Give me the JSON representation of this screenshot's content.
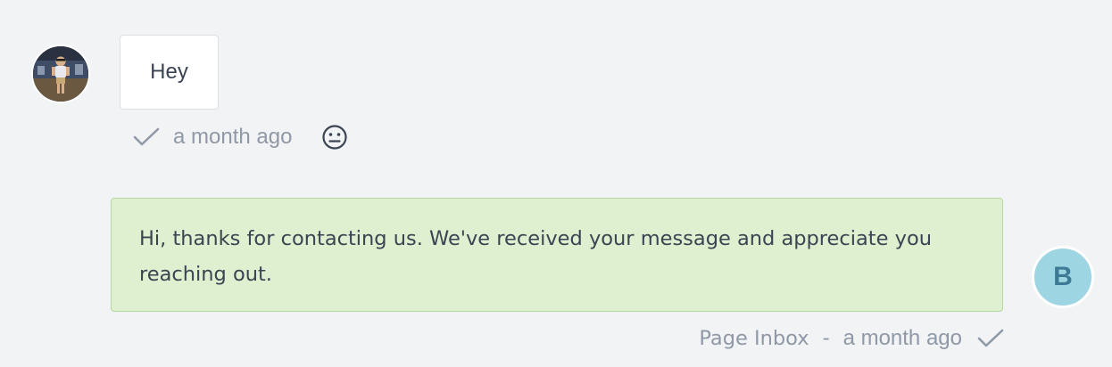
{
  "incoming": {
    "text": "Hey",
    "time": "a month ago",
    "status_icon": "check-icon",
    "reaction_icon": "emoji-smile-icon"
  },
  "outgoing": {
    "text": "Hi, thanks for contacting us. We've received your message and appreciate you reaching out.",
    "source": "Page Inbox",
    "separator": "-",
    "time": "a month ago",
    "status_icon": "check-icon",
    "avatar_letter": "B"
  },
  "colors": {
    "background": "#f2f3f5",
    "outgoing_bubble": "#dff0d0",
    "outgoing_border": "#b6d7a0",
    "avatar_b_bg": "#9ed5e2",
    "avatar_b_text": "#3c7a96",
    "muted_text": "#8f98a6"
  }
}
